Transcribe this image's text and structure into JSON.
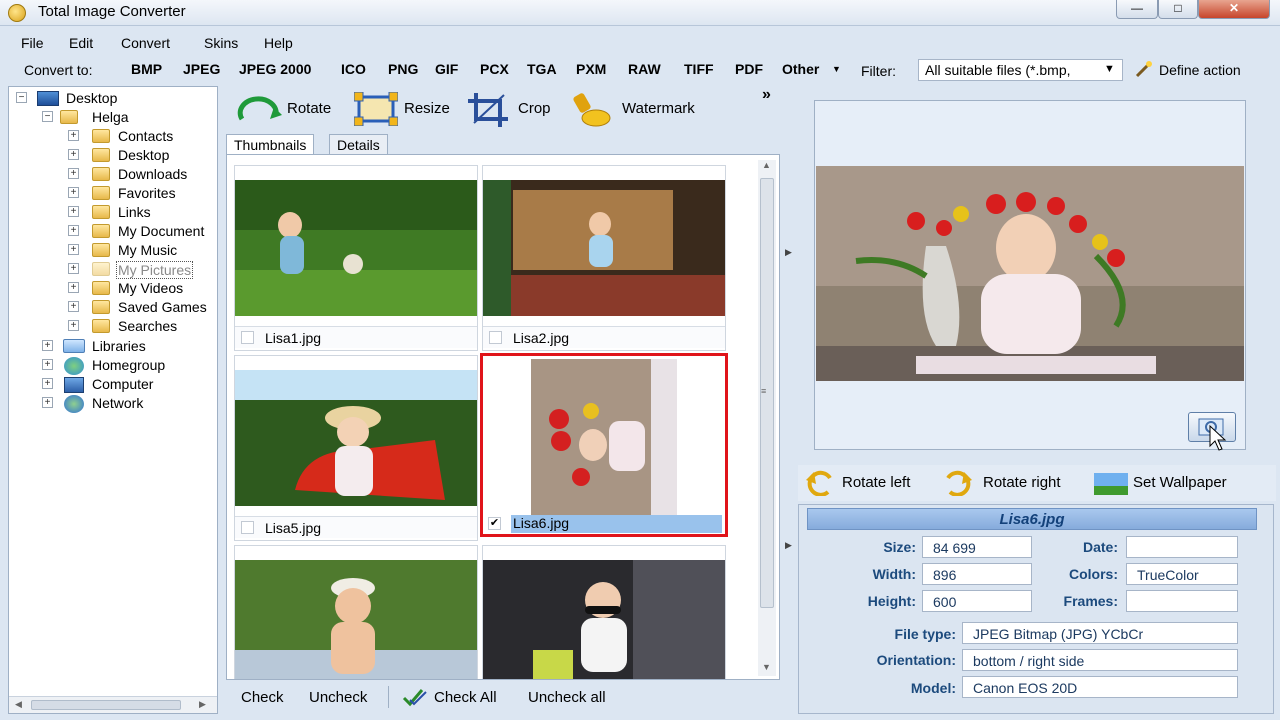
{
  "window": {
    "title": "Total Image Converter",
    "minimize": "—",
    "maximize": "□",
    "close": "✕"
  },
  "menu": [
    "File",
    "Edit",
    "Convert",
    "Skins",
    "Help"
  ],
  "convert_bar": {
    "label": "Convert to:",
    "formats": [
      "BMP",
      "JPEG",
      "JPEG 2000",
      "ICO",
      "PNG",
      "GIF",
      "PCX",
      "TGA",
      "PXM",
      "RAW",
      "TIFF",
      "PDF",
      "Other"
    ],
    "filter_label": "Filter:",
    "filter_value": "All suitable files (*.bmp,",
    "define_action": "Define action"
  },
  "tree": [
    {
      "label": "Desktop"
    },
    {
      "label": "Helga"
    },
    {
      "label": "Contacts"
    },
    {
      "label": "Desktop"
    },
    {
      "label": "Downloads"
    },
    {
      "label": "Favorites"
    },
    {
      "label": "Links"
    },
    {
      "label": "My Document"
    },
    {
      "label": "My Music"
    },
    {
      "label": "My Pictures"
    },
    {
      "label": "My Videos"
    },
    {
      "label": "Saved Games"
    },
    {
      "label": "Searches"
    },
    {
      "label": "Libraries"
    },
    {
      "label": "Homegroup"
    },
    {
      "label": "Computer"
    },
    {
      "label": "Network"
    }
  ],
  "toolbar": {
    "rotate": "Rotate",
    "resize": "Resize",
    "crop": "Crop",
    "watermark": "Watermark",
    "more": "»"
  },
  "tabs": {
    "thumbnails": "Thumbnails",
    "details": "Details"
  },
  "thumbnails": [
    {
      "name": "Lisa1.jpg",
      "checked": false
    },
    {
      "name": "Lisa2.jpg",
      "checked": false
    },
    {
      "name": "Lisa5.jpg",
      "checked": false
    },
    {
      "name": "Lisa6.jpg",
      "checked": true,
      "check_mark": "✔"
    }
  ],
  "bottom_bar": {
    "check": "Check",
    "uncheck": "Uncheck",
    "check_all": "Check All",
    "uncheck_all": "Uncheck all"
  },
  "preview_actions": {
    "rotate_left": "Rotate left",
    "rotate_right": "Rotate right",
    "set_wallpaper": "Set Wallpaper"
  },
  "info": {
    "title": "Lisa6.jpg",
    "size_label": "Size:",
    "size": "84 699",
    "date_label": "Date:",
    "date": "",
    "width_label": "Width:",
    "width": "896",
    "colors_label": "Colors:",
    "colors": "TrueColor",
    "height_label": "Height:",
    "height": "600",
    "frames_label": "Frames:",
    "frames": "",
    "filetype_label": "File type:",
    "filetype": "JPEG Bitmap (JPG) YCbCr",
    "orientation_label": "Orientation:",
    "orientation": "bottom / right side",
    "model_label": "Model:",
    "model": "Canon EOS 20D"
  },
  "colors": {
    "selection_border": "#e0141a",
    "selected_caption": "#99c2ec",
    "accent": "#1c4a7d"
  }
}
